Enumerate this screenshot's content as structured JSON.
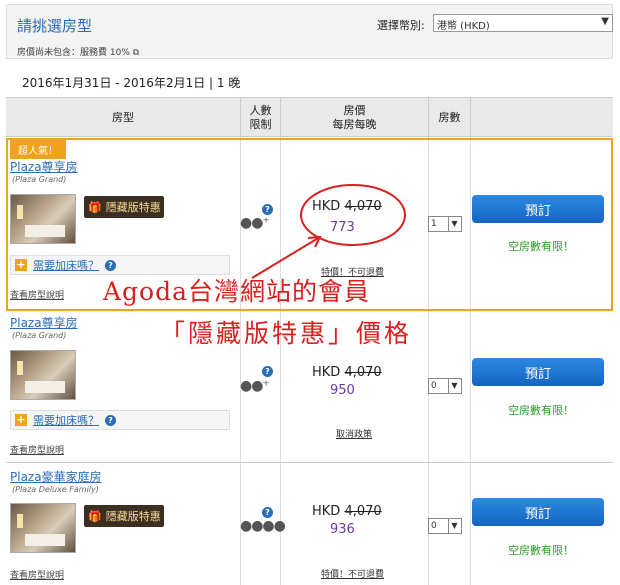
{
  "header": {
    "title": "請挑選房型",
    "tax_note": "房價尚未包含：服務費 10%",
    "currency_label": "選擇幣別:",
    "currency_value": "港幣 (HKD)"
  },
  "dates": "2016年1月31日 - 2016年2月1日 | 1 晚",
  "columns": {
    "room_type": "房型",
    "occupancy": "人數\n限制",
    "price": "房價\n每房每晚",
    "rooms": "房數"
  },
  "rows": [
    {
      "badge": "超人氣！",
      "name": "Plaza尊享房",
      "subname": "(Plaza Grand)",
      "promo": "隱藏版特惠",
      "extra_bed": "需要加床嗎？",
      "details": "查看房型說明",
      "currency": "HKD",
      "old_price": "4,070",
      "new_price": "773",
      "note": "特價！不可退費",
      "qty": "1",
      "book": "預訂",
      "availability": "空房數有限！"
    },
    {
      "name": "Plaza尊享房",
      "subname": "(Plaza Grand)",
      "extra_bed": "需要加床嗎？",
      "details": "查看房型說明",
      "currency": "HKD",
      "old_price": "4,070",
      "new_price": "950",
      "note": "取消政策",
      "qty": "0",
      "book": "預訂",
      "availability": "空房數有限！"
    },
    {
      "name": "Plaza豪華家庭房",
      "subname": "(Plaza Deluxe Family)",
      "promo": "隱藏版特惠",
      "details": "查看房型說明",
      "currency": "HKD",
      "old_price": "4,070",
      "new_price": "936",
      "note": "特價！不可退費",
      "qty": "0",
      "book": "預訂",
      "availability": "空房數有限！"
    }
  ],
  "annotation": {
    "line1": "Agoda台灣網站的會員",
    "line2": "「隱藏版特惠」價格"
  },
  "colors": {
    "accent_blue": "#2a6db5",
    "highlight_orange": "#f0a21b",
    "annotation_red": "#d8201f",
    "price_purple": "#6a3da0",
    "availability_green": "#2e9b2e"
  }
}
